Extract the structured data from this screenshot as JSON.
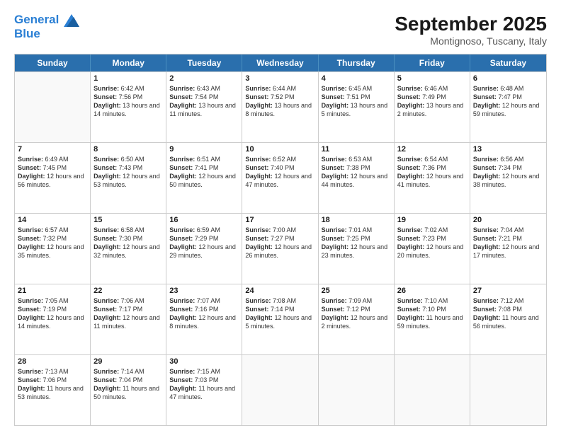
{
  "header": {
    "logo_line1": "General",
    "logo_line2": "Blue",
    "month_title": "September 2025",
    "location": "Montignoso, Tuscany, Italy"
  },
  "weekdays": [
    "Sunday",
    "Monday",
    "Tuesday",
    "Wednesday",
    "Thursday",
    "Friday",
    "Saturday"
  ],
  "weeks": [
    [
      {
        "day": "",
        "empty": true
      },
      {
        "day": "1",
        "sunrise": "6:42 AM",
        "sunset": "7:56 PM",
        "daylight": "13 hours and 14 minutes."
      },
      {
        "day": "2",
        "sunrise": "6:43 AM",
        "sunset": "7:54 PM",
        "daylight": "13 hours and 11 minutes."
      },
      {
        "day": "3",
        "sunrise": "6:44 AM",
        "sunset": "7:52 PM",
        "daylight": "13 hours and 8 minutes."
      },
      {
        "day": "4",
        "sunrise": "6:45 AM",
        "sunset": "7:51 PM",
        "daylight": "13 hours and 5 minutes."
      },
      {
        "day": "5",
        "sunrise": "6:46 AM",
        "sunset": "7:49 PM",
        "daylight": "13 hours and 2 minutes."
      },
      {
        "day": "6",
        "sunrise": "6:48 AM",
        "sunset": "7:47 PM",
        "daylight": "12 hours and 59 minutes."
      }
    ],
    [
      {
        "day": "7",
        "sunrise": "6:49 AM",
        "sunset": "7:45 PM",
        "daylight": "12 hours and 56 minutes."
      },
      {
        "day": "8",
        "sunrise": "6:50 AM",
        "sunset": "7:43 PM",
        "daylight": "12 hours and 53 minutes."
      },
      {
        "day": "9",
        "sunrise": "6:51 AM",
        "sunset": "7:41 PM",
        "daylight": "12 hours and 50 minutes."
      },
      {
        "day": "10",
        "sunrise": "6:52 AM",
        "sunset": "7:40 PM",
        "daylight": "12 hours and 47 minutes."
      },
      {
        "day": "11",
        "sunrise": "6:53 AM",
        "sunset": "7:38 PM",
        "daylight": "12 hours and 44 minutes."
      },
      {
        "day": "12",
        "sunrise": "6:54 AM",
        "sunset": "7:36 PM",
        "daylight": "12 hours and 41 minutes."
      },
      {
        "day": "13",
        "sunrise": "6:56 AM",
        "sunset": "7:34 PM",
        "daylight": "12 hours and 38 minutes."
      }
    ],
    [
      {
        "day": "14",
        "sunrise": "6:57 AM",
        "sunset": "7:32 PM",
        "daylight": "12 hours and 35 minutes."
      },
      {
        "day": "15",
        "sunrise": "6:58 AM",
        "sunset": "7:30 PM",
        "daylight": "12 hours and 32 minutes."
      },
      {
        "day": "16",
        "sunrise": "6:59 AM",
        "sunset": "7:29 PM",
        "daylight": "12 hours and 29 minutes."
      },
      {
        "day": "17",
        "sunrise": "7:00 AM",
        "sunset": "7:27 PM",
        "daylight": "12 hours and 26 minutes."
      },
      {
        "day": "18",
        "sunrise": "7:01 AM",
        "sunset": "7:25 PM",
        "daylight": "12 hours and 23 minutes."
      },
      {
        "day": "19",
        "sunrise": "7:02 AM",
        "sunset": "7:23 PM",
        "daylight": "12 hours and 20 minutes."
      },
      {
        "day": "20",
        "sunrise": "7:04 AM",
        "sunset": "7:21 PM",
        "daylight": "12 hours and 17 minutes."
      }
    ],
    [
      {
        "day": "21",
        "sunrise": "7:05 AM",
        "sunset": "7:19 PM",
        "daylight": "12 hours and 14 minutes."
      },
      {
        "day": "22",
        "sunrise": "7:06 AM",
        "sunset": "7:17 PM",
        "daylight": "12 hours and 11 minutes."
      },
      {
        "day": "23",
        "sunrise": "7:07 AM",
        "sunset": "7:16 PM",
        "daylight": "12 hours and 8 minutes."
      },
      {
        "day": "24",
        "sunrise": "7:08 AM",
        "sunset": "7:14 PM",
        "daylight": "12 hours and 5 minutes."
      },
      {
        "day": "25",
        "sunrise": "7:09 AM",
        "sunset": "7:12 PM",
        "daylight": "12 hours and 2 minutes."
      },
      {
        "day": "26",
        "sunrise": "7:10 AM",
        "sunset": "7:10 PM",
        "daylight": "11 hours and 59 minutes."
      },
      {
        "day": "27",
        "sunrise": "7:12 AM",
        "sunset": "7:08 PM",
        "daylight": "11 hours and 56 minutes."
      }
    ],
    [
      {
        "day": "28",
        "sunrise": "7:13 AM",
        "sunset": "7:06 PM",
        "daylight": "11 hours and 53 minutes."
      },
      {
        "day": "29",
        "sunrise": "7:14 AM",
        "sunset": "7:04 PM",
        "daylight": "11 hours and 50 minutes."
      },
      {
        "day": "30",
        "sunrise": "7:15 AM",
        "sunset": "7:03 PM",
        "daylight": "11 hours and 47 minutes."
      },
      {
        "day": "",
        "empty": true
      },
      {
        "day": "",
        "empty": true
      },
      {
        "day": "",
        "empty": true
      },
      {
        "day": "",
        "empty": true
      }
    ]
  ],
  "labels": {
    "sunrise": "Sunrise:",
    "sunset": "Sunset:",
    "daylight": "Daylight:"
  }
}
